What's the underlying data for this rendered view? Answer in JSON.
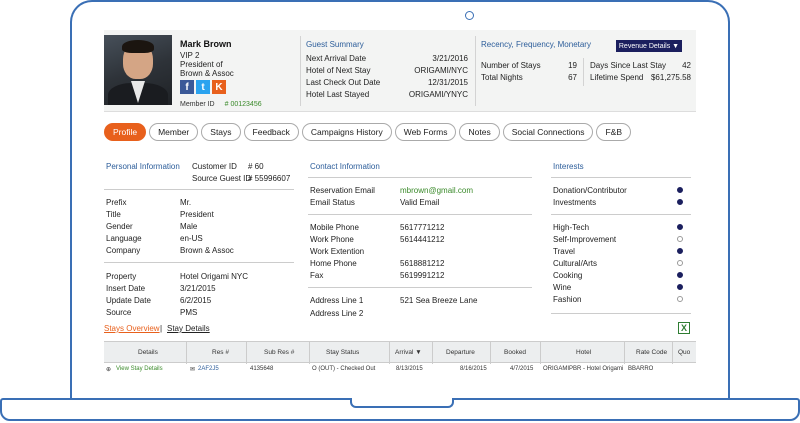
{
  "guest": {
    "name": "Mark Brown",
    "tier": "VIP 2",
    "title_line1": "President of",
    "title_line2": "Brown & Assoc",
    "member_label": "Member ID",
    "member_id": "# 00123456",
    "socials": [
      "f",
      "t",
      "K"
    ]
  },
  "summary": {
    "title": "Guest Summary",
    "rows": [
      {
        "label": "Next Arrival Date",
        "value": "3/21/2016"
      },
      {
        "label": "Hotel of Next Stay",
        "value": "ORIGAMI/NYC"
      },
      {
        "label": "Last Check Out Date",
        "value": "12/31/2015"
      },
      {
        "label": "Hotel Last Stayed",
        "value": "ORIGAMI/YNYC"
      }
    ]
  },
  "rfm": {
    "title": "Recency, Frequency, Monetary",
    "button": "Revenue Details ▼",
    "rows": [
      {
        "label": "Number of Stays",
        "value": "19"
      },
      {
        "label": "Total Nights",
        "value": "67"
      }
    ],
    "rows2": [
      {
        "label": "Days Since Last Stay",
        "value": "42"
      },
      {
        "label": "Lifetime Spend",
        "value": "$61,275.58"
      }
    ]
  },
  "tabs": [
    "Profile",
    "Member",
    "Stays",
    "Feedback",
    "Campaigns History",
    "Web Forms",
    "Notes",
    "Social Connections",
    "F&B"
  ],
  "personal": {
    "title": "Personal Information",
    "customer_id_label": "Customer ID",
    "customer_id": "# 60",
    "source_guest_id_label": "Source Guest ID",
    "source_guest_id": "# 55996607",
    "group1": [
      {
        "label": "Prefix",
        "value": "Mr."
      },
      {
        "label": "Title",
        "value": "President"
      },
      {
        "label": "Gender",
        "value": "Male"
      },
      {
        "label": "Language",
        "value": "en-US"
      },
      {
        "label": "Company",
        "value": "Brown & Assoc"
      }
    ],
    "group2": [
      {
        "label": "Property",
        "value": "Hotel Origami NYC"
      },
      {
        "label": "Insert Date",
        "value": "3/21/2015"
      },
      {
        "label": "Update Date",
        "value": "6/2/2015"
      },
      {
        "label": "Source",
        "value": "PMS"
      }
    ]
  },
  "contact": {
    "title": "Contact Information",
    "group1": [
      {
        "label": "Reservation Email",
        "value": "mbrown@gmail.com"
      },
      {
        "label": "Email Status",
        "value": "Valid Email"
      }
    ],
    "group2": [
      {
        "label": "Mobile Phone",
        "value": "5617771212"
      },
      {
        "label": "Work Phone",
        "value": "5614441212"
      },
      {
        "label": "Work Extention",
        "value": ""
      },
      {
        "label": "Home Phone",
        "value": "5618881212"
      },
      {
        "label": "Fax",
        "value": "5619991212"
      }
    ],
    "group3": [
      {
        "label": "Address Line 1",
        "value": "521 Sea Breeze Lane"
      },
      {
        "label": "Address Line 2",
        "value": ""
      }
    ]
  },
  "interests": {
    "title": "Interests",
    "group1": [
      {
        "label": "Donation/Contributor",
        "on": true
      },
      {
        "label": "Investments",
        "on": true
      }
    ],
    "group2": [
      {
        "label": "High-Tech",
        "on": true
      },
      {
        "label": "Self-Improvement",
        "on": false
      },
      {
        "label": "Travel",
        "on": true
      },
      {
        "label": "Cultural/Arts",
        "on": false
      },
      {
        "label": "Cooking",
        "on": true
      },
      {
        "label": "Wine",
        "on": true
      },
      {
        "label": "Fashion",
        "on": false
      }
    ]
  },
  "stays": {
    "overview_link": "Stays Overview",
    "details_link": "Stay Details",
    "excel": "X",
    "columns": [
      "Details",
      "Res #",
      "Sub Res #",
      "Stay Status",
      "Arrival ▼",
      "Departure",
      "Booked",
      "Hotel",
      "Rate Code",
      "Quo"
    ],
    "row": {
      "details": "View Stay Details",
      "res": "2AF2J5",
      "sub_res": "4135648",
      "status": "O (OUT) - Checked Out",
      "arrival": "8/13/2015",
      "departure": "8/16/2015",
      "booked": "4/7/2015",
      "hotel": "ORIGAMIPBR - Hotel Origami",
      "rate": "BBARRO"
    }
  },
  "colors": {
    "accent": "#e8601c",
    "navy": "#1b1f5e",
    "link_blue": "#2c5d9a",
    "green": "#3a8a2a",
    "frame": "#3a6fb5"
  }
}
